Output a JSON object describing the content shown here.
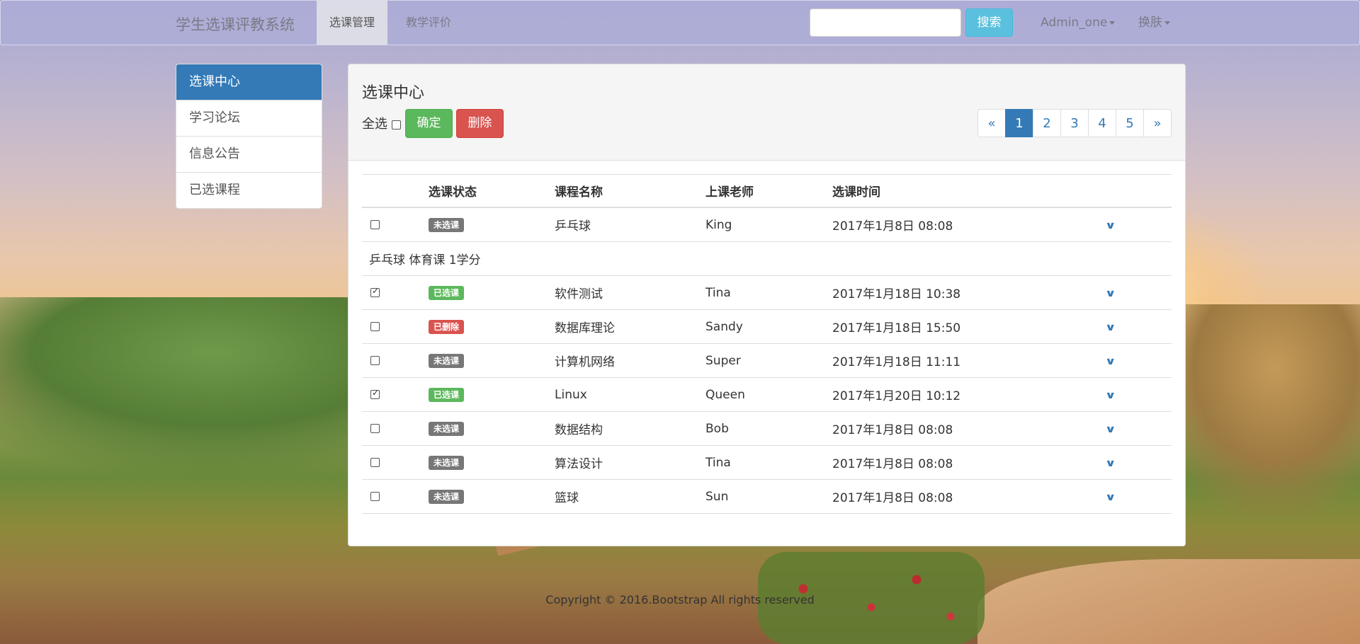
{
  "navbar": {
    "brand": "学生选课评教系统",
    "tabs": [
      {
        "label": "选课管理",
        "active": true
      },
      {
        "label": "教学评价",
        "active": false
      }
    ],
    "search_button": "搜索",
    "user_menu": "Admin_one",
    "skin_menu": "换肤"
  },
  "sidebar": {
    "items": [
      {
        "label": "选课中心",
        "active": true
      },
      {
        "label": "学习论坛",
        "active": false
      },
      {
        "label": "信息公告",
        "active": false
      },
      {
        "label": "已选课程",
        "active": false
      }
    ]
  },
  "panel": {
    "title": "选课中心",
    "select_all": "全选",
    "confirm_button": "确定",
    "delete_button": "删除",
    "pagination": [
      "«",
      "1",
      "2",
      "3",
      "4",
      "5",
      "»"
    ],
    "active_page": "1"
  },
  "table": {
    "headers": [
      "选课状态",
      "课程名称",
      "上课老师",
      "选课时间"
    ],
    "rows": [
      {
        "checked": false,
        "status": "未选课",
        "status_type": "default",
        "course": "乒乓球",
        "teacher": "King",
        "time": "2017年1月8日 08:08"
      },
      {
        "checked": true,
        "status": "已选课",
        "status_type": "success",
        "course": "软件测试",
        "teacher": "Tina",
        "time": "2017年1月18日 10:38"
      },
      {
        "checked": false,
        "status": "已删除",
        "status_type": "danger",
        "course": "数据库理论",
        "teacher": "Sandy",
        "time": "2017年1月18日 15:50"
      },
      {
        "checked": false,
        "status": "未选课",
        "status_type": "default",
        "course": "计算机网络",
        "teacher": "Super",
        "time": "2017年1月18日 11:11"
      },
      {
        "checked": true,
        "status": "已选课",
        "status_type": "success",
        "course": "Linux",
        "teacher": "Queen",
        "time": "2017年1月20日 10:12"
      },
      {
        "checked": false,
        "status": "未选课",
        "status_type": "default",
        "course": "数据结构",
        "teacher": "Bob",
        "time": "2017年1月8日 08:08"
      },
      {
        "checked": false,
        "status": "未选课",
        "status_type": "default",
        "course": "算法设计",
        "teacher": "Tina",
        "time": "2017年1月8日 08:08"
      },
      {
        "checked": false,
        "status": "未选课",
        "status_type": "default",
        "course": "篮球",
        "teacher": "Sun",
        "time": "2017年1月8日 08:08"
      }
    ],
    "expanded_detail": "乒乓球 体育课 1学分"
  },
  "footer": "Copyright © 2016.Bootstrap All rights reserved",
  "colors": {
    "primary": "#337ab7",
    "success": "#5cb85c",
    "danger": "#d9534f",
    "info": "#5bc0de",
    "label_default": "#777777"
  }
}
